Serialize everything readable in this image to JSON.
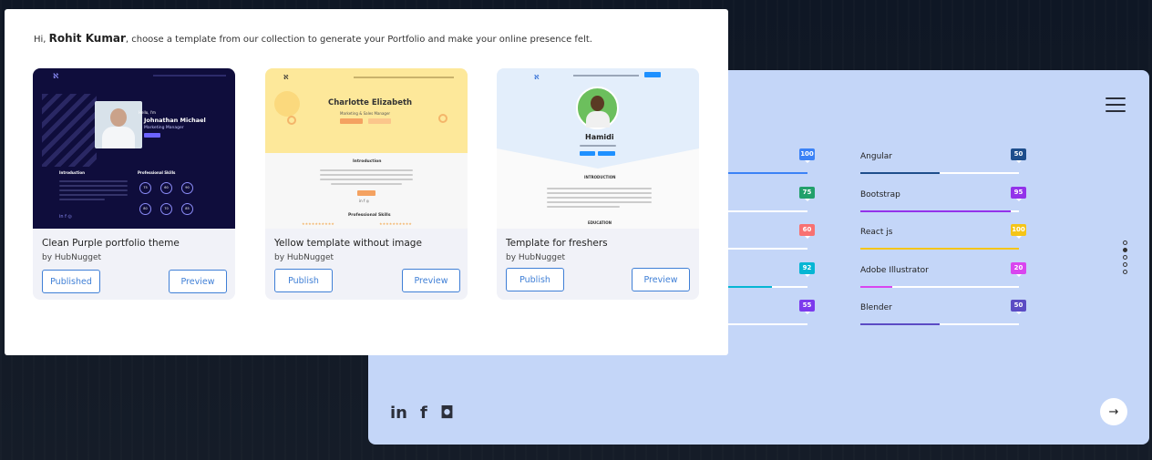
{
  "greeting": {
    "prefix": "Hi, ",
    "user_name": "Rohit Kumar",
    "message": ", choose a template from our collection to generate your Portfolio and make your online presence felt."
  },
  "templates": [
    {
      "title": "Clean Purple portfolio theme",
      "author": "by HubNugget",
      "primary_label": "Published",
      "preview_label": "Preview",
      "thumb": {
        "greeting": "Hello, I'm",
        "name": "Johnathan Michael",
        "role": "Marketing Manager",
        "section_intro": "Introduction",
        "section_skills": "Professional Skills",
        "skill_values": [
          "75",
          "60",
          "90",
          "80",
          "70",
          "85"
        ]
      }
    },
    {
      "title": "Yellow template without image",
      "author": "by HubNugget",
      "primary_label": "Publish",
      "preview_label": "Preview",
      "thumb": {
        "name": "Charlotte Elizabeth",
        "role": "Marketing & Sales Manager",
        "section_intro": "Introduction",
        "section_skills": "Professional Skills"
      }
    },
    {
      "title": "Template for freshers",
      "author": "by HubNugget",
      "primary_label": "Publish",
      "preview_label": "Preview",
      "thumb": {
        "name": "Hamidi",
        "section_intro": "INTRODUCTION",
        "section_education": "EDUCATION"
      }
    }
  ],
  "background_portfolio": {
    "skills_left": [
      {
        "value": "100",
        "level": 1.0,
        "color": "#3b82f6"
      },
      {
        "value": "75",
        "level": 0.75,
        "color": "#22a06b"
      },
      {
        "value": "60",
        "level": 0.6,
        "color": "#f87171"
      },
      {
        "value": "92",
        "level": 0.92,
        "color": "#06b6d4"
      },
      {
        "value": "55",
        "level": 0.55,
        "color": "#7c3aed"
      }
    ],
    "skills_right": [
      {
        "name": "Angular",
        "value": "50",
        "level": 0.5,
        "color": "#1e4e8c"
      },
      {
        "name": "Bootstrap",
        "value": "95",
        "level": 0.95,
        "color": "#9333ea"
      },
      {
        "name": "React js",
        "value": "100",
        "level": 1.0,
        "color": "#f5c518"
      },
      {
        "name": "Adobe Illustrator",
        "value": "20",
        "level": 0.2,
        "color": "#d946ef"
      },
      {
        "name": "Blender",
        "value": "50",
        "level": 0.5,
        "color": "#5b4bc4"
      }
    ],
    "social_icons": [
      "linkedin-icon",
      "facebook-icon",
      "instagram-icon"
    ],
    "social_glyphs": [
      "in",
      "f",
      "◘"
    ],
    "next_icon": "→"
  }
}
